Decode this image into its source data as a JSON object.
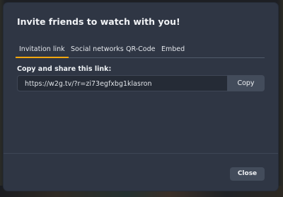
{
  "dialog": {
    "title": "Invite friends to watch with you!",
    "tabs": [
      {
        "label": "Invitation link",
        "active": true
      },
      {
        "label": "Social networks",
        "active": false
      },
      {
        "label": "QR-Code",
        "active": false
      },
      {
        "label": "Embed",
        "active": false
      }
    ],
    "share_label": "Copy and share this link:",
    "link_value": "https://w2g.tv/?r=zi73egfxbg1klasron",
    "copy_label": "Copy",
    "close_label": "Close"
  },
  "colors": {
    "dialog_bg": "#2f3644",
    "tab_accent": "#f2a70f",
    "button_bg": "#434c5b",
    "input_bg": "#252b36"
  }
}
